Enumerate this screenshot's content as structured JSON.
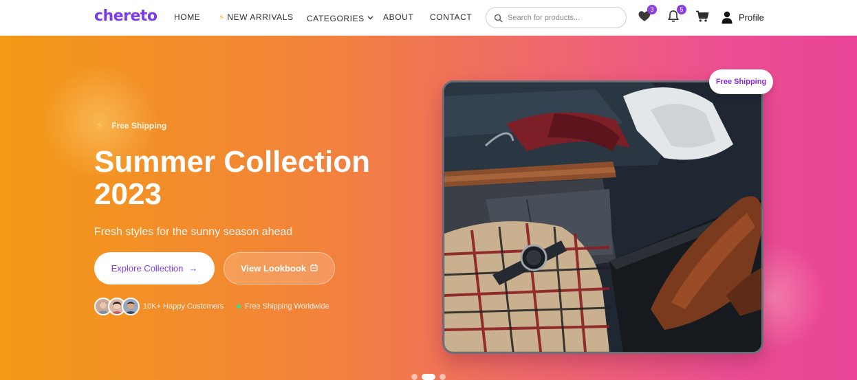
{
  "brand": {
    "logo": "chereto",
    "accent": "#7c3aed"
  },
  "nav": {
    "home": "HOME",
    "new_arrivals": "NEW ARRIVALS",
    "categories": "CATEGORIES",
    "about": "ABOUT",
    "contact": "CONTACT"
  },
  "search": {
    "placeholder": "Search for products...",
    "value": ""
  },
  "header_icons": {
    "wishlist": {
      "icon": "heart-icon",
      "count": "3"
    },
    "notifications": {
      "icon": "bell-icon",
      "count": "5"
    },
    "cart": {
      "icon": "cart-icon"
    },
    "profile": {
      "icon": "user-icon",
      "label": "Profile"
    }
  },
  "hero": {
    "tag": "Free Shipping",
    "title": "Summer Collection 2023",
    "subtitle": "Fresh styles for the sunny season ahead",
    "primary_button": "Explore Collection",
    "secondary_button": "View Lookbook",
    "customers_text": "10K+ Happy Customers",
    "shipping_text": "Free Shipping Worldwide",
    "image_badge": "Free Shipping",
    "colors": {
      "gradient_start": "#f39a16",
      "gradient_end": "#e94497",
      "badge_text": "#8a2be2"
    }
  },
  "carousel": {
    "slides": 3,
    "active_index": 1
  }
}
